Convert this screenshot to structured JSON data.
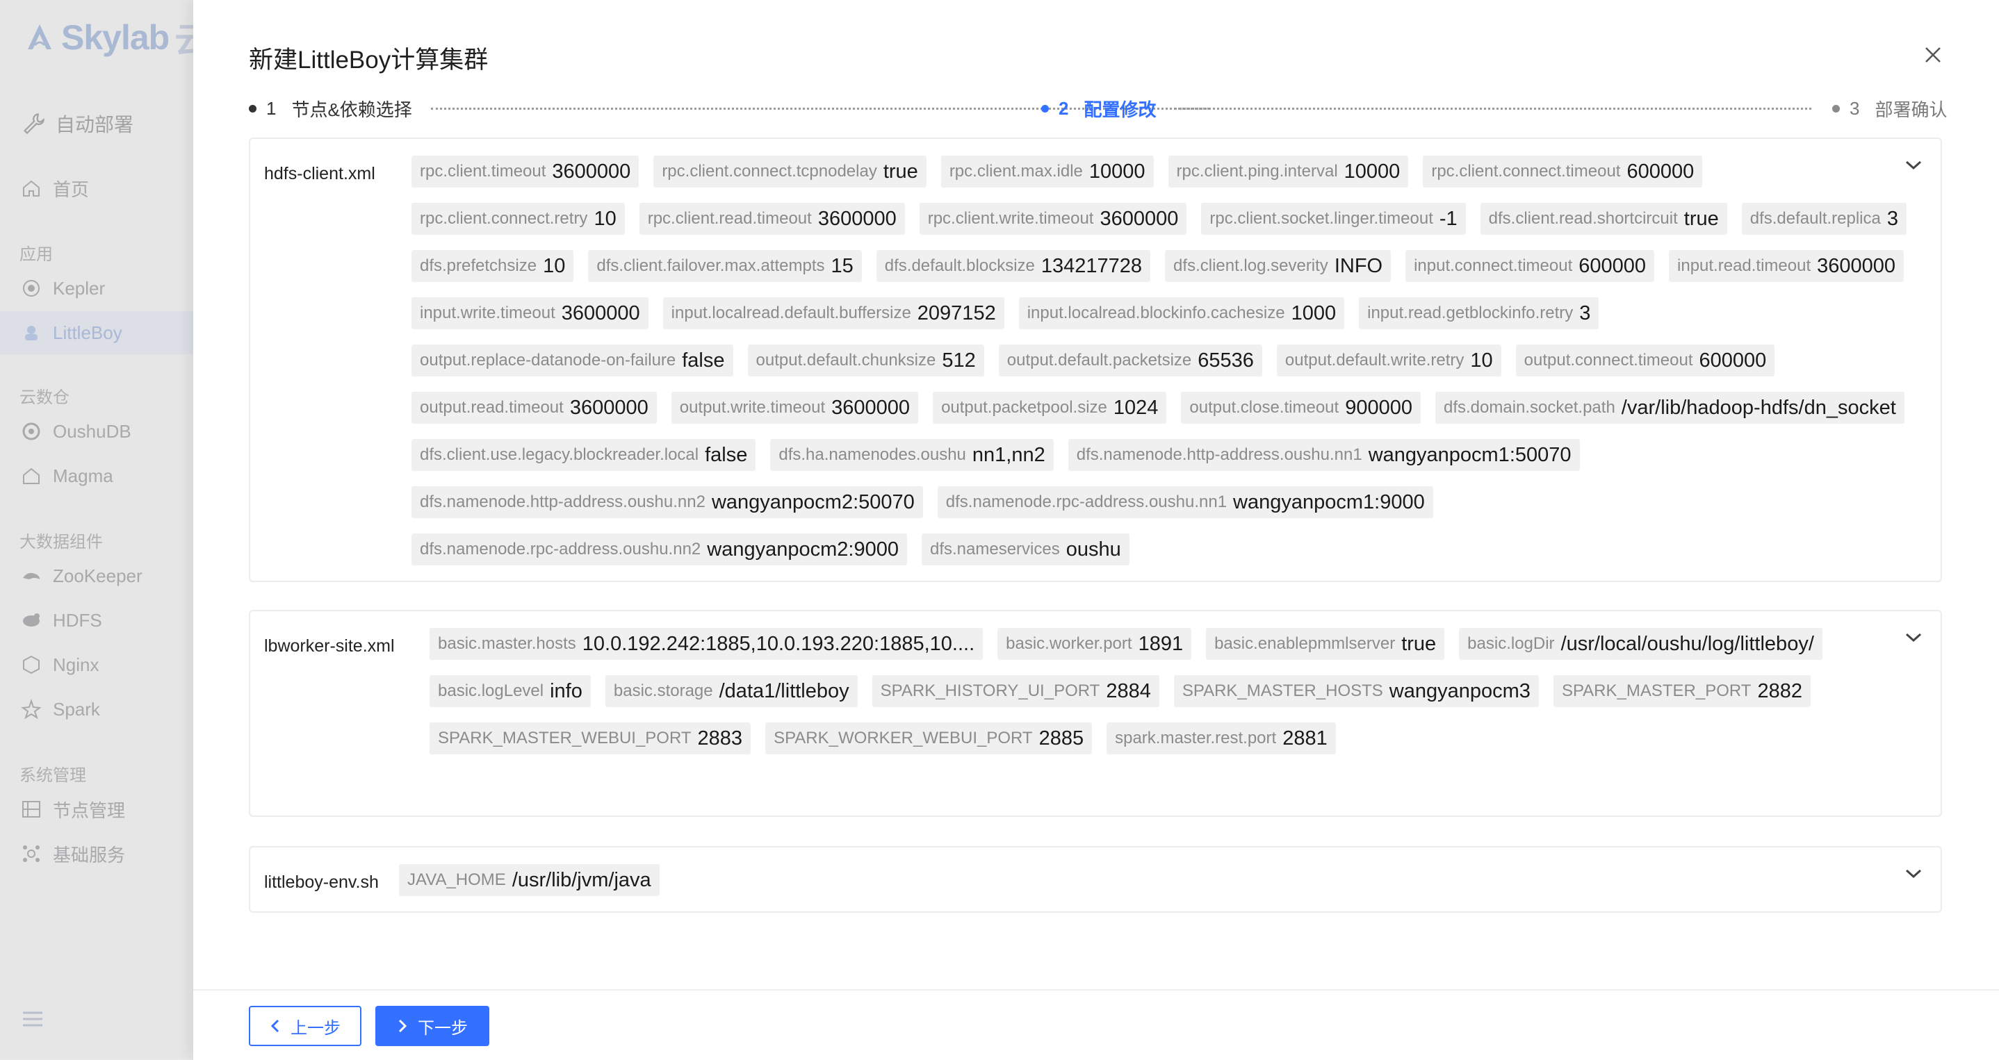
{
  "sidebar": {
    "brand": "Skylab",
    "brand_suffix": "云",
    "top_section": "自动部署",
    "home": "首页",
    "groups": [
      {
        "title": "应用",
        "items": [
          "Kepler",
          "LittleBoy"
        ]
      },
      {
        "title": "云数仓",
        "items": [
          "OushuDB",
          "Magma"
        ]
      },
      {
        "title": "大数据组件",
        "items": [
          "ZooKeeper",
          "HDFS",
          "Nginx",
          "Spark"
        ]
      },
      {
        "title": "系统管理",
        "items": [
          "节点管理",
          "基础服务"
        ]
      }
    ],
    "active_item": "LittleBoy"
  },
  "drawer": {
    "title": "新建LittleBoy计算集群",
    "steps": [
      {
        "num": "1",
        "label": "节点&依赖选择",
        "state": "done"
      },
      {
        "num": "2",
        "label": "配置修改",
        "state": "active"
      },
      {
        "num": "3",
        "label": "部署确认",
        "state": "todo"
      }
    ]
  },
  "configs": [
    {
      "file": "hdfs-client.xml",
      "items": [
        {
          "k": "rpc.client.timeout",
          "v": "3600000"
        },
        {
          "k": "rpc.client.connect.tcpnodelay",
          "v": "true"
        },
        {
          "k": "rpc.client.max.idle",
          "v": "10000"
        },
        {
          "k": "rpc.client.ping.interval",
          "v": "10000"
        },
        {
          "k": "rpc.client.connect.timeout",
          "v": "600000"
        },
        {
          "k": "rpc.client.connect.retry",
          "v": "10"
        },
        {
          "k": "rpc.client.read.timeout",
          "v": "3600000"
        },
        {
          "k": "rpc.client.write.timeout",
          "v": "3600000"
        },
        {
          "k": "rpc.client.socket.linger.timeout",
          "v": "-1"
        },
        {
          "k": "dfs.client.read.shortcircuit",
          "v": "true"
        },
        {
          "k": "dfs.default.replica",
          "v": "3"
        },
        {
          "k": "dfs.prefetchsize",
          "v": "10"
        },
        {
          "k": "dfs.client.failover.max.attempts",
          "v": "15"
        },
        {
          "k": "dfs.default.blocksize",
          "v": "134217728"
        },
        {
          "k": "dfs.client.log.severity",
          "v": "INFO"
        },
        {
          "k": "input.connect.timeout",
          "v": "600000"
        },
        {
          "k": "input.read.timeout",
          "v": "3600000"
        },
        {
          "k": "input.write.timeout",
          "v": "3600000"
        },
        {
          "k": "input.localread.default.buffersize",
          "v": "2097152"
        },
        {
          "k": "input.localread.blockinfo.cachesize",
          "v": "1000"
        },
        {
          "k": "input.read.getblockinfo.retry",
          "v": "3"
        },
        {
          "k": "output.replace-datanode-on-failure",
          "v": "false"
        },
        {
          "k": "output.default.chunksize",
          "v": "512"
        },
        {
          "k": "output.default.packetsize",
          "v": "65536"
        },
        {
          "k": "output.default.write.retry",
          "v": "10"
        },
        {
          "k": "output.connect.timeout",
          "v": "600000"
        },
        {
          "k": "output.read.timeout",
          "v": "3600000"
        },
        {
          "k": "output.write.timeout",
          "v": "3600000"
        },
        {
          "k": "output.packetpool.size",
          "v": "1024"
        },
        {
          "k": "output.close.timeout",
          "v": "900000"
        },
        {
          "k": "dfs.domain.socket.path",
          "v": "/var/lib/hadoop-hdfs/dn_socket"
        },
        {
          "k": "dfs.client.use.legacy.blockreader.local",
          "v": "false"
        },
        {
          "k": "dfs.ha.namenodes.oushu",
          "v": "nn1,nn2"
        },
        {
          "k": "dfs.namenode.http-address.oushu.nn1",
          "v": "wangyanpocm1:50070"
        },
        {
          "k": "dfs.namenode.http-address.oushu.nn2",
          "v": "wangyanpocm2:50070"
        },
        {
          "k": "dfs.namenode.rpc-address.oushu.nn1",
          "v": "wangyanpocm1:9000"
        },
        {
          "k": "dfs.namenode.rpc-address.oushu.nn2",
          "v": "wangyanpocm2:9000"
        },
        {
          "k": "dfs.nameservices",
          "v": "oushu"
        }
      ]
    },
    {
      "file": "lbworker-site.xml",
      "items": [
        {
          "k": "basic.master.hosts",
          "v": "10.0.192.242:1885,10.0.193.220:1885,10...."
        },
        {
          "k": "basic.worker.port",
          "v": "1891"
        },
        {
          "k": "basic.enablepmmlserver",
          "v": "true"
        },
        {
          "k": "basic.logDir",
          "v": "/usr/local/oushu/log/littleboy/"
        },
        {
          "k": "basic.logLevel",
          "v": "info"
        },
        {
          "k": "basic.storage",
          "v": "/data1/littleboy"
        },
        {
          "k": "SPARK_HISTORY_UI_PORT",
          "v": "2884"
        },
        {
          "k": "SPARK_MASTER_HOSTS",
          "v": "wangyanpocm3"
        },
        {
          "k": "SPARK_MASTER_PORT",
          "v": "2882"
        },
        {
          "k": "SPARK_MASTER_WEBUI_PORT",
          "v": "2883"
        },
        {
          "k": "SPARK_WORKER_WEBUI_PORT",
          "v": "2885"
        },
        {
          "k": "spark.master.rest.port",
          "v": "2881"
        }
      ]
    },
    {
      "file": "littleboy-env.sh",
      "items": [
        {
          "k": "JAVA_HOME",
          "v": "/usr/lib/jvm/java"
        }
      ]
    }
  ],
  "footer": {
    "prev_label": "上一步",
    "next_label": "下一步"
  },
  "colors": {
    "accent": "#3370ff",
    "tag_bg": "#f0f0f0"
  }
}
